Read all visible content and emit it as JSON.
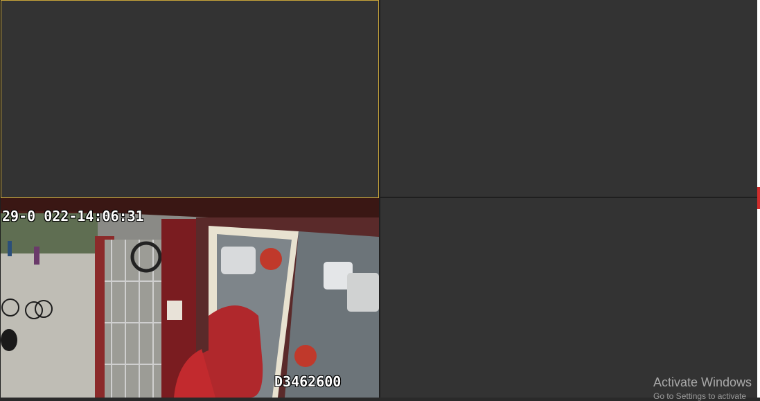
{
  "viewer": {
    "camera_feed": {
      "timestamp_overlay": "29-0  022-14:06:31",
      "camera_id_overlay": "D3462600"
    }
  },
  "watermark": {
    "title": "Activate Windows",
    "subtitle": "Go to Settings to activate"
  },
  "colors": {
    "selected_tile_border": "#c9a53a",
    "empty_tile": "#333333",
    "scroll_marker": "#d22d2d"
  }
}
